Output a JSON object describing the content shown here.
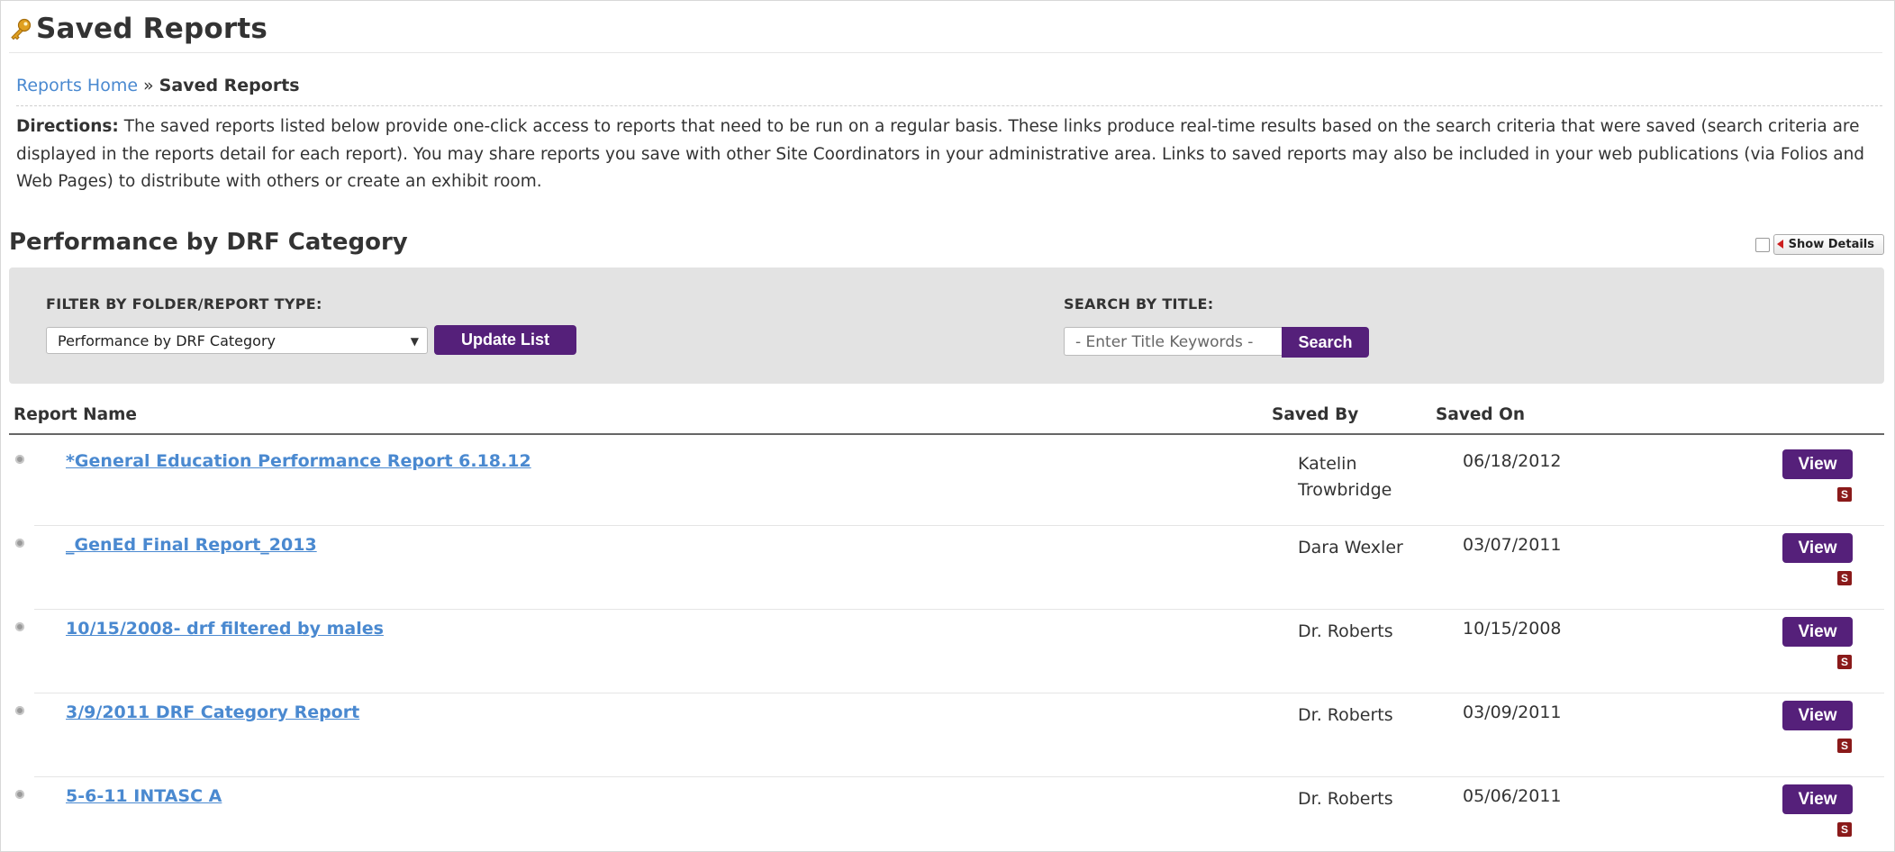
{
  "page": {
    "title": "Saved Reports",
    "icon": "key-icon"
  },
  "breadcrumb": {
    "home": "Reports Home",
    "separator": "»",
    "current": "Saved Reports"
  },
  "directions": {
    "label": "Directions:",
    "text": " The saved reports listed below provide one-click access to reports that need to be run on a regular basis. These links produce real-time results based on the search criteria that were saved (search criteria are displayed in the reports detail for each report). You may share reports you save with other Site Coordinators in your administrative area. Links to saved reports may also be included in your web publications (via Folios and Web Pages) to distribute with others or create an exhibit room."
  },
  "section": {
    "title": "Performance by DRF Category",
    "show_details_label": "Show Details"
  },
  "filter": {
    "folder_label": "FILTER BY FOLDER/REPORT TYPE:",
    "folder_selected": "Performance by DRF Category",
    "update_button": "Update List",
    "search_label": "SEARCH BY TITLE:",
    "search_placeholder": "- Enter Title Keywords -",
    "search_button": "Search"
  },
  "table": {
    "headers": {
      "name": "Report Name",
      "saved_by": "Saved By",
      "saved_on": "Saved On"
    },
    "rows": [
      {
        "name": "*General Education Performance Report 6.18.12",
        "saved_by": "Katelin Trowbridge",
        "saved_on": "06/18/2012",
        "action": "View",
        "badge": "S"
      },
      {
        "name": "_GenEd Final Report_2013",
        "saved_by": "Dara Wexler",
        "saved_on": "03/07/2011",
        "action": "View",
        "badge": "S"
      },
      {
        "name": "10/15/2008- drf filtered by males",
        "saved_by": "Dr. Roberts",
        "saved_on": "10/15/2008",
        "action": "View",
        "badge": "S"
      },
      {
        "name": "3/9/2011 DRF Category Report",
        "saved_by": "Dr. Roberts",
        "saved_on": "03/09/2011",
        "action": "View",
        "badge": "S"
      },
      {
        "name": "5-6-11 INTASC A",
        "saved_by": "Dr. Roberts",
        "saved_on": "05/06/2011",
        "action": "View",
        "badge": "S"
      }
    ]
  },
  "colors": {
    "link": "#4a89d0",
    "button_purple": "#55207a",
    "badge_red": "#8a1a1a",
    "panel_gray": "#e3e3e3"
  }
}
